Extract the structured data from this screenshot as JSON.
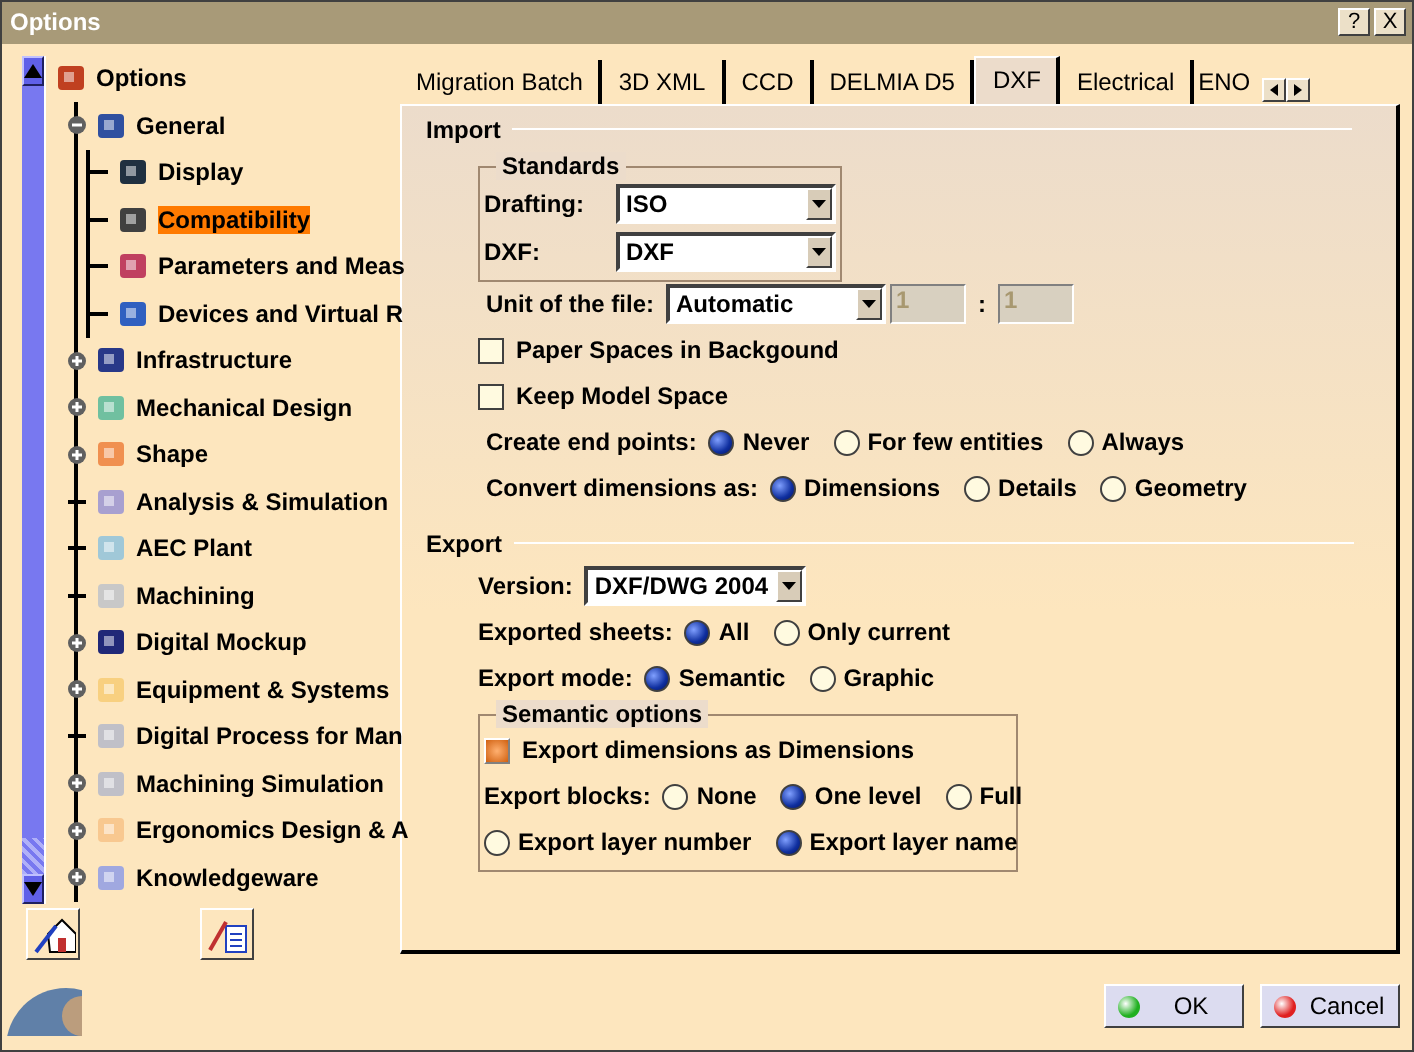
{
  "window": {
    "title": "Options",
    "buttons": [
      "?",
      "X"
    ]
  },
  "tree": {
    "label": "Options",
    "children": [
      {
        "label": "General",
        "kind": "group",
        "expanded": true,
        "color": "#3050a0",
        "children": [
          {
            "label": "Display",
            "selected": false,
            "color": "#203040"
          },
          {
            "label": "Compatibility",
            "selected": true,
            "color": "#404040"
          },
          {
            "label": "Parameters and Meas",
            "selected": false,
            "color": "#c04060"
          },
          {
            "label": "Devices and Virtual R",
            "selected": false,
            "color": "#3060c0"
          }
        ]
      },
      {
        "label": "Infrastructure",
        "kind": "group",
        "expanded": false,
        "color": "#283888"
      },
      {
        "label": "Mechanical Design",
        "kind": "group",
        "expanded": false,
        "color": "#70c0a0"
      },
      {
        "label": "Shape",
        "kind": "group",
        "expanded": false,
        "color": "#f09050"
      },
      {
        "label": "Analysis & Simulation",
        "kind": "leaf",
        "color": "#a8a0d0"
      },
      {
        "label": "AEC Plant",
        "kind": "leaf",
        "color": "#a0c8d8"
      },
      {
        "label": "Machining",
        "kind": "leaf",
        "color": "#c8c8c8"
      },
      {
        "label": "Digital Mockup",
        "kind": "group",
        "expanded": false,
        "color": "#202878"
      },
      {
        "label": "Equipment & Systems",
        "kind": "group",
        "expanded": false,
        "color": "#f8d080"
      },
      {
        "label": "Digital Process for Man",
        "kind": "leaf",
        "color": "#c0c0c8"
      },
      {
        "label": "Machining Simulation",
        "kind": "group",
        "expanded": false,
        "color": "#c0c0c8"
      },
      {
        "label": "Ergonomics Design & A",
        "kind": "group",
        "expanded": false,
        "color": "#f8c890"
      },
      {
        "label": "Knowledgeware",
        "kind": "group",
        "expanded": false,
        "color": "#a0a8e0"
      }
    ]
  },
  "tabs": [
    {
      "label": "Migration Batch",
      "selected": false
    },
    {
      "label": "3D XML",
      "selected": false
    },
    {
      "label": "CCD",
      "selected": false
    },
    {
      "label": "DELMIA D5",
      "selected": false
    },
    {
      "label": "DXF",
      "selected": true
    },
    {
      "label": "Electrical",
      "selected": false
    },
    {
      "label": "ENO",
      "selected": false
    }
  ],
  "import": {
    "title": "Import",
    "standards": {
      "title": "Standards",
      "fields": [
        {
          "label": "Drafting:",
          "value": "ISO"
        },
        {
          "label": "DXF:",
          "value": "DXF"
        }
      ]
    },
    "unit": {
      "label": "Unit of the file:",
      "value": "Automatic",
      "ratio": [
        {
          "value": "1",
          "disabled": true
        },
        {
          "value": "1",
          "disabled": true
        }
      ],
      "separator": ":"
    },
    "checkboxes": [
      {
        "label": "Paper Spaces in Backgound",
        "checked": false
      },
      {
        "label": "Keep Model Space",
        "checked": false
      }
    ],
    "radio_groups": [
      {
        "label": "Create end points:",
        "options": [
          {
            "label": "Never",
            "selected": true
          },
          {
            "label": "For few entities",
            "selected": false
          },
          {
            "label": "Always",
            "selected": false
          }
        ]
      },
      {
        "label": "Convert dimensions as:",
        "options": [
          {
            "label": "Dimensions",
            "selected": true
          },
          {
            "label": "Details",
            "selected": false
          },
          {
            "label": "Geometry",
            "selected": false
          }
        ]
      }
    ]
  },
  "export": {
    "title": "Export",
    "version": {
      "label": "Version:",
      "value": "DXF/DWG 2004"
    },
    "radio_groups": [
      {
        "label": "Exported sheets:",
        "options": [
          {
            "label": "All",
            "selected": true
          },
          {
            "label": "Only current",
            "selected": false
          }
        ]
      },
      {
        "label": "Export mode:",
        "options": [
          {
            "label": "Semantic",
            "selected": true
          },
          {
            "label": "Graphic",
            "selected": false
          }
        ]
      }
    ],
    "semantic": {
      "title": "Semantic options",
      "checkbox": {
        "label": "Export dimensions as Dimensions",
        "checked": true
      },
      "radio_groups": [
        {
          "label": "Export blocks:",
          "options": [
            {
              "label": "None",
              "selected": false
            },
            {
              "label": "One level",
              "selected": true
            },
            {
              "label": "Full",
              "selected": false
            }
          ]
        },
        {
          "options": [
            {
              "label": "Export layer number",
              "selected": false
            },
            {
              "label": "Export layer name",
              "selected": true
            }
          ]
        }
      ]
    }
  },
  "buttons": [
    {
      "label": "OK",
      "kind": "ok"
    },
    {
      "label": "Cancel",
      "kind": "cancel"
    }
  ]
}
